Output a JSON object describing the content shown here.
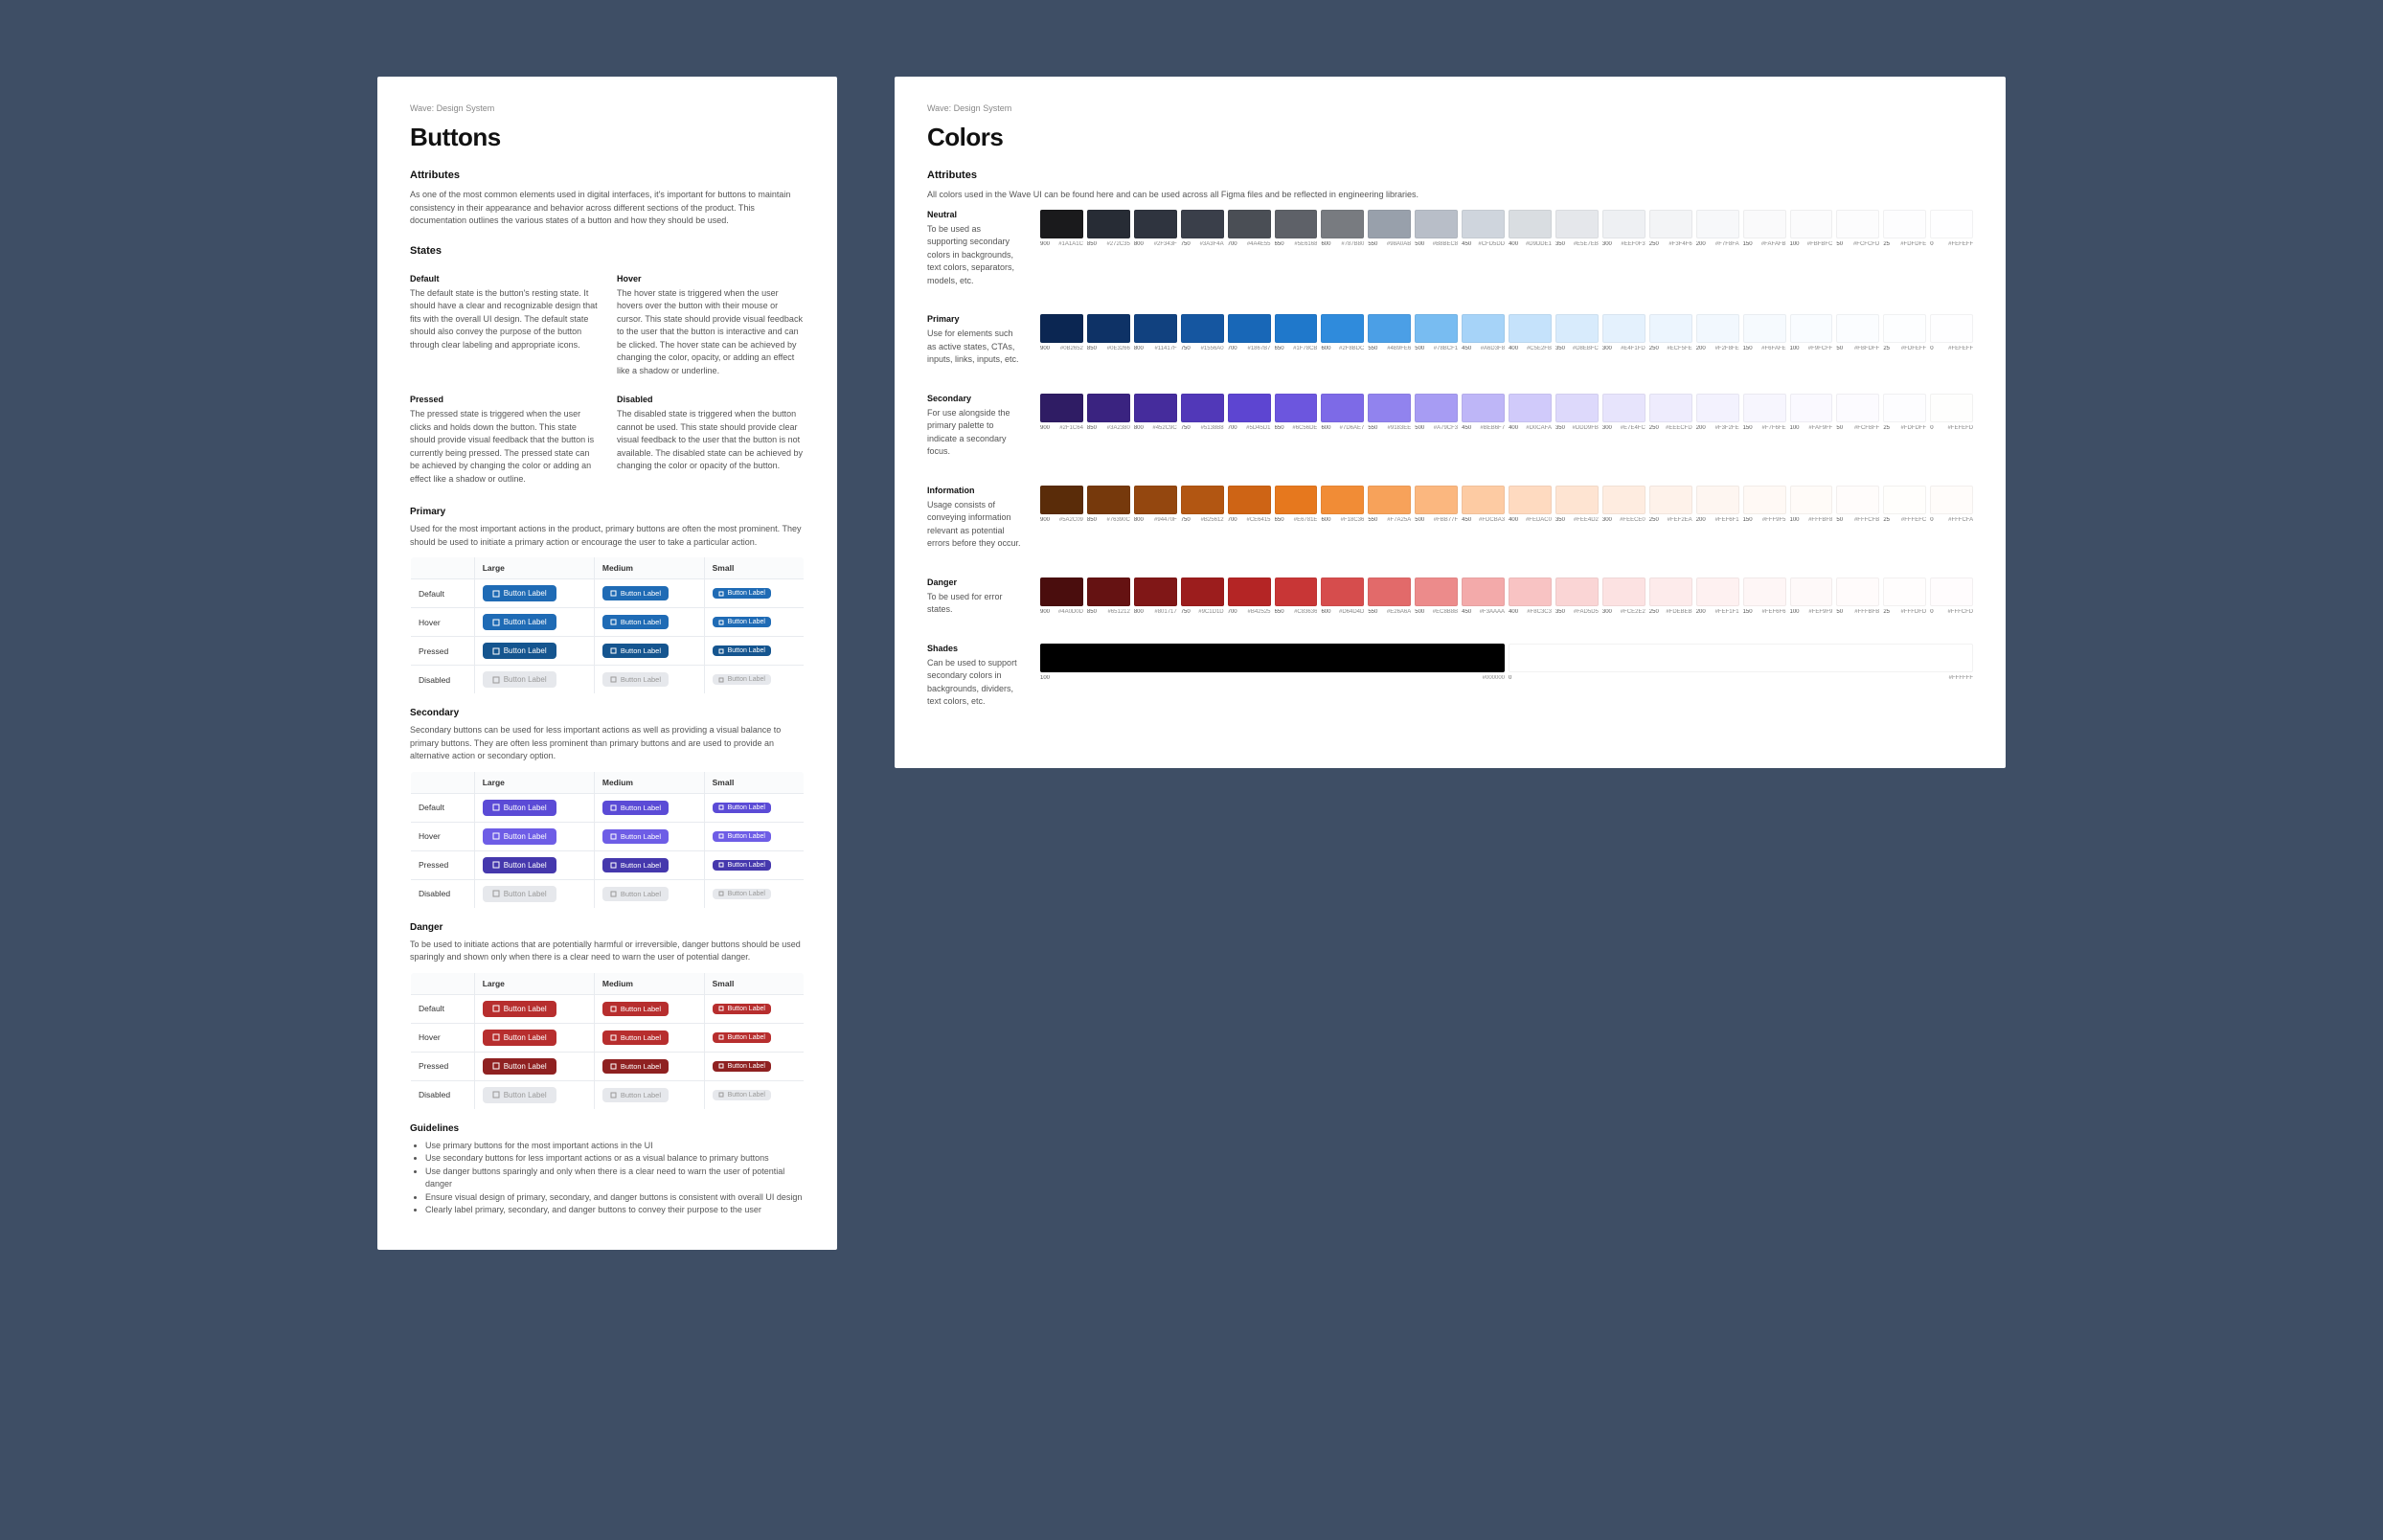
{
  "buttons": {
    "breadcrumb": "Wave: Design System",
    "title": "Buttons",
    "attributes_h": "Attributes",
    "attributes_p": "As one of the most common elements used in digital interfaces, it's important for buttons to maintain consistency in their appearance and behavior across different sections of the product. This documentation outlines the various states of a button and how they should be used.",
    "states_h": "States",
    "states": {
      "default_h": "Default",
      "default_p": "The default state is the button's resting state. It should have a clear and recognizable design that fits with the overall UI design. The default state should also convey the purpose of the button through clear labeling and appropriate icons.",
      "hover_h": "Hover",
      "hover_p": "The hover state is triggered when the user hovers over the button with their mouse or cursor. This state should provide visual feedback to the user that the button is interactive and can be clicked. The hover state can be achieved by changing the color, opacity, or adding an effect like a shadow or underline.",
      "pressed_h": "Pressed",
      "pressed_p": "The pressed state is triggered when the user clicks and holds down the button. This state should provide visual feedback that the button is currently being pressed. The pressed state can be achieved by changing the color or adding an effect like a shadow or outline.",
      "disabled_h": "Disabled",
      "disabled_p": "The disabled state is triggered when the button cannot be used. This state should provide clear visual feedback to the user that the button is not available. The disabled state can be achieved by changing the color or opacity of the button."
    },
    "table_headers": {
      "large": "Large",
      "medium": "Medium",
      "small": "Small"
    },
    "row_labels": {
      "default": "Default",
      "hover": "Hover",
      "pressed": "Pressed",
      "disabled": "Disabled"
    },
    "btn_label": "Button Label",
    "primary_h": "Primary",
    "primary_p": "Used for the most important actions in the product, primary buttons are often the most prominent. They should be used to initiate a primary action or encourage the user to take a particular action.",
    "secondary_h": "Secondary",
    "secondary_p": "Secondary buttons can be used for less important actions as well as providing a visual balance to primary buttons. They are often less prominent than primary buttons and are used to provide an alternative action or secondary option.",
    "danger_h": "Danger",
    "danger_p": "To be used to initiate actions that are potentially harmful or irreversible, danger buttons should be used sparingly and shown only when there is a clear need to warn the user of potential danger.",
    "guidelines_h": "Guidelines",
    "guidelines": [
      "Use primary buttons for the most important actions in the UI",
      "Use secondary buttons for less important actions or as a visual balance to primary buttons",
      "Use danger buttons sparingly and only when there is a clear need to warn the user of potential danger",
      "Ensure visual design of primary, secondary, and danger buttons is consistent with overall UI design",
      "Clearly label primary, secondary, and danger buttons to convey their purpose to the user"
    ]
  },
  "colors": {
    "breadcrumb": "Wave: Design System",
    "title": "Colors",
    "attributes_h": "Attributes",
    "attributes_p": "All colors used in the Wave UI can be found here and can be used across all Figma files and be reflected in engineering libraries.",
    "groups": [
      {
        "name": "Neutral",
        "desc": "To be used as supporting secondary colors in backgrounds, text colors, separators, models, etc.",
        "swatches": [
          {
            "step": "900",
            "hex": "#1A1A1C"
          },
          {
            "step": "850",
            "hex": "#272C35"
          },
          {
            "step": "800",
            "hex": "#2F343F"
          },
          {
            "step": "750",
            "hex": "#3A3F4A"
          },
          {
            "step": "700",
            "hex": "#4A4E55"
          },
          {
            "step": "650",
            "hex": "#5E6168"
          },
          {
            "step": "600",
            "hex": "#787B80"
          },
          {
            "step": "550",
            "hex": "#98A0AB"
          },
          {
            "step": "500",
            "hex": "#B8BEC8"
          },
          {
            "step": "450",
            "hex": "#CFD5DD"
          },
          {
            "step": "400",
            "hex": "#D9DDE1"
          },
          {
            "step": "350",
            "hex": "#E5E7EB"
          },
          {
            "step": "300",
            "hex": "#EEF0F3"
          },
          {
            "step": "250",
            "hex": "#F3F4F6"
          },
          {
            "step": "200",
            "hex": "#F7F8FA"
          },
          {
            "step": "150",
            "hex": "#FAFAFB"
          },
          {
            "step": "100",
            "hex": "#FBFBFC"
          },
          {
            "step": "50",
            "hex": "#FCFCFD"
          },
          {
            "step": "25",
            "hex": "#FDFDFE"
          },
          {
            "step": "0",
            "hex": "#FEFEFF"
          }
        ]
      },
      {
        "name": "Primary",
        "desc": "Use for elements such as active states, CTAs, inputs, links, inputs, etc.",
        "swatches": [
          {
            "step": "900",
            "hex": "#0B2652"
          },
          {
            "step": "850",
            "hex": "#0E3266"
          },
          {
            "step": "800",
            "hex": "#11417F"
          },
          {
            "step": "750",
            "hex": "#1556A0"
          },
          {
            "step": "700",
            "hex": "#1867B7"
          },
          {
            "step": "650",
            "hex": "#1F78CB"
          },
          {
            "step": "600",
            "hex": "#2F8BDC"
          },
          {
            "step": "550",
            "hex": "#4B9FE6"
          },
          {
            "step": "500",
            "hex": "#78BCF1"
          },
          {
            "step": "450",
            "hex": "#A6D3F8"
          },
          {
            "step": "400",
            "hex": "#C5E2FB"
          },
          {
            "step": "350",
            "hex": "#D8EBFC"
          },
          {
            "step": "300",
            "hex": "#E4F1FD"
          },
          {
            "step": "250",
            "hex": "#ECF5FE"
          },
          {
            "step": "200",
            "hex": "#F2F8FE"
          },
          {
            "step": "150",
            "hex": "#F6FAFE"
          },
          {
            "step": "100",
            "hex": "#F9FCFF"
          },
          {
            "step": "50",
            "hex": "#FBFDFF"
          },
          {
            "step": "25",
            "hex": "#FDFEFF"
          },
          {
            "step": "0",
            "hex": "#FEFEFF"
          }
        ]
      },
      {
        "name": "Secondary",
        "desc": "For use alongside the primary palette to indicate a secondary focus.",
        "swatches": [
          {
            "step": "900",
            "hex": "#2F1C64"
          },
          {
            "step": "850",
            "hex": "#3A2380"
          },
          {
            "step": "800",
            "hex": "#452C9C"
          },
          {
            "step": "750",
            "hex": "#5138B8"
          },
          {
            "step": "700",
            "hex": "#5D45D1"
          },
          {
            "step": "650",
            "hex": "#6C56DE"
          },
          {
            "step": "600",
            "hex": "#7D6AE7"
          },
          {
            "step": "550",
            "hex": "#9183EE"
          },
          {
            "step": "500",
            "hex": "#A79CF3"
          },
          {
            "step": "450",
            "hex": "#BEB6F7"
          },
          {
            "step": "400",
            "hex": "#D0CAFA"
          },
          {
            "step": "350",
            "hex": "#DDD9FB"
          },
          {
            "step": "300",
            "hex": "#E7E4FC"
          },
          {
            "step": "250",
            "hex": "#EEECFD"
          },
          {
            "step": "200",
            "hex": "#F3F2FE"
          },
          {
            "step": "150",
            "hex": "#F7F6FE"
          },
          {
            "step": "100",
            "hex": "#FAF9FF"
          },
          {
            "step": "50",
            "hex": "#FCFBFF"
          },
          {
            "step": "25",
            "hex": "#FDFDFF"
          },
          {
            "step": "0",
            "hex": "#FEFEFD"
          }
        ]
      },
      {
        "name": "Information",
        "desc": "Usage consists of conveying information relevant as potential errors before they occur.",
        "swatches": [
          {
            "step": "900",
            "hex": "#5A2C09"
          },
          {
            "step": "850",
            "hex": "#76390C"
          },
          {
            "step": "800",
            "hex": "#94470F"
          },
          {
            "step": "750",
            "hex": "#B25612"
          },
          {
            "step": "700",
            "hex": "#CE6415"
          },
          {
            "step": "650",
            "hex": "#E6781E"
          },
          {
            "step": "600",
            "hex": "#F18C36"
          },
          {
            "step": "550",
            "hex": "#F7A25A"
          },
          {
            "step": "500",
            "hex": "#FBB77F"
          },
          {
            "step": "450",
            "hex": "#FDCBA3"
          },
          {
            "step": "400",
            "hex": "#FEDAC0"
          },
          {
            "step": "350",
            "hex": "#FEE4D2"
          },
          {
            "step": "300",
            "hex": "#FEECE0"
          },
          {
            "step": "250",
            "hex": "#FEF2EA"
          },
          {
            "step": "200",
            "hex": "#FEF6F1"
          },
          {
            "step": "150",
            "hex": "#FFF9F5"
          },
          {
            "step": "100",
            "hex": "#FFFBF8"
          },
          {
            "step": "50",
            "hex": "#FFFCFB"
          },
          {
            "step": "25",
            "hex": "#FFFEFC"
          },
          {
            "step": "0",
            "hex": "#FFFCFA"
          }
        ]
      },
      {
        "name": "Danger",
        "desc": "To be used for error states.",
        "swatches": [
          {
            "step": "900",
            "hex": "#4A0D0D"
          },
          {
            "step": "850",
            "hex": "#651212"
          },
          {
            "step": "800",
            "hex": "#801717"
          },
          {
            "step": "750",
            "hex": "#9C1D1D"
          },
          {
            "step": "700",
            "hex": "#B42525"
          },
          {
            "step": "650",
            "hex": "#C83636"
          },
          {
            "step": "600",
            "hex": "#D64D4D"
          },
          {
            "step": "550",
            "hex": "#E26A6A"
          },
          {
            "step": "500",
            "hex": "#EC8B8B"
          },
          {
            "step": "450",
            "hex": "#F3AAAA"
          },
          {
            "step": "400",
            "hex": "#F8C3C3"
          },
          {
            "step": "350",
            "hex": "#FAD5D5"
          },
          {
            "step": "300",
            "hex": "#FCE2E2"
          },
          {
            "step": "250",
            "hex": "#FDEBEB"
          },
          {
            "step": "200",
            "hex": "#FEF1F1"
          },
          {
            "step": "150",
            "hex": "#FEF6F6"
          },
          {
            "step": "100",
            "hex": "#FEF9F9"
          },
          {
            "step": "50",
            "hex": "#FFFBFB"
          },
          {
            "step": "25",
            "hex": "#FFFDFD"
          },
          {
            "step": "0",
            "hex": "#FFFCFD"
          }
        ]
      },
      {
        "name": "Shades",
        "desc": "Can be used to support secondary colors in backgrounds, dividers, text colors, etc.",
        "swatches": [
          {
            "step": "100",
            "hex": "#000000"
          },
          {
            "step": "0",
            "hex": "#FFFFFF"
          }
        ]
      }
    ]
  }
}
